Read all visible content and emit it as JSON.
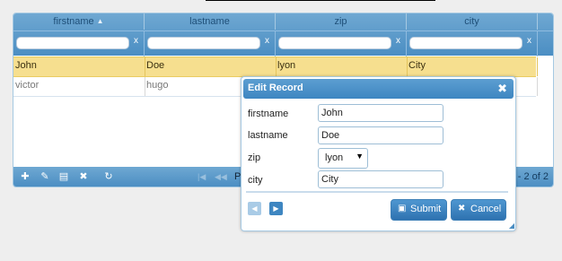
{
  "grid": {
    "columns": [
      {
        "title": "firstname"
      },
      {
        "title": "lastname"
      },
      {
        "title": "zip"
      },
      {
        "title": "city"
      }
    ],
    "filter_clear_label": "x",
    "rows": [
      {
        "firstname": "John",
        "lastname": "Doe",
        "zip": "lyon",
        "city": "City"
      },
      {
        "firstname": "victor",
        "lastname": "hugo",
        "zip": "",
        "city": ""
      }
    ],
    "footer": {
      "icons": [
        "add-icon",
        "edit-icon",
        "view-icon",
        "delete-icon",
        "refresh-icon"
      ],
      "pager_prefix": "P",
      "view_info": "- 2 of 2"
    }
  },
  "dialog": {
    "title": "Edit Record",
    "fields": {
      "firstname": {
        "label": "firstname",
        "value": "John"
      },
      "lastname": {
        "label": "lastname",
        "value": "Doe"
      },
      "zip": {
        "label": "zip",
        "value": "lyon"
      },
      "city": {
        "label": "city",
        "value": "City"
      }
    },
    "submit_label": "Submit",
    "cancel_label": "Cancel"
  },
  "colors": {
    "header_blue": "#4b8ec3",
    "selected_row": "#f6df8f",
    "button_blue": "#2e72b0"
  }
}
